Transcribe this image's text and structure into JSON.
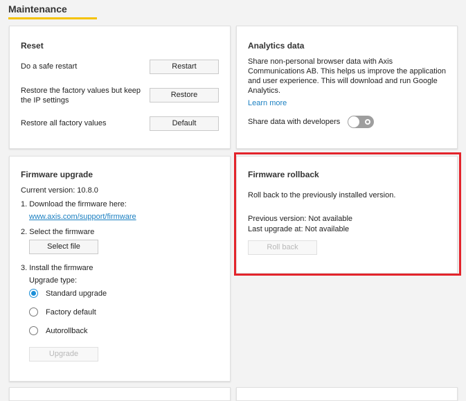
{
  "page": {
    "title": "Maintenance"
  },
  "reset": {
    "title": "Reset",
    "rows": [
      {
        "label": "Do a safe restart",
        "button": "Restart"
      },
      {
        "label": "Restore the factory values but keep the IP settings",
        "button": "Restore"
      },
      {
        "label": "Restore all factory values",
        "button": "Default"
      }
    ]
  },
  "analytics": {
    "title": "Analytics data",
    "description": "Share non-personal browser data with Axis Communications AB. This helps us improve the application and user experience. This will download and run Google Analytics.",
    "learn_more": "Learn more",
    "share_label": "Share data with developers",
    "share_enabled": false
  },
  "firmware_upgrade": {
    "title": "Firmware upgrade",
    "current_version": "Current version: 10.8.0",
    "step1": "1. Download the firmware here:",
    "link": "www.axis.com/support/firmware",
    "step2": "2. Select the firmware",
    "select_button": "Select file",
    "step3": "3. Install the firmware",
    "upgrade_type_label": "Upgrade type:",
    "options": [
      "Standard upgrade",
      "Factory default",
      "Autorollback"
    ],
    "selected_option": "Standard upgrade",
    "upgrade_button": "Upgrade"
  },
  "firmware_rollback": {
    "title": "Firmware rollback",
    "description": "Roll back to the previously installed version.",
    "previous_version": "Previous version: Not available",
    "last_upgrade": "Last upgrade at: Not available",
    "rollback_button": "Roll back"
  },
  "colors": {
    "accent": "#f5c200",
    "link": "#1a7fc1",
    "highlight": "#e3242b",
    "radio_selected": "#1a8fd8"
  }
}
